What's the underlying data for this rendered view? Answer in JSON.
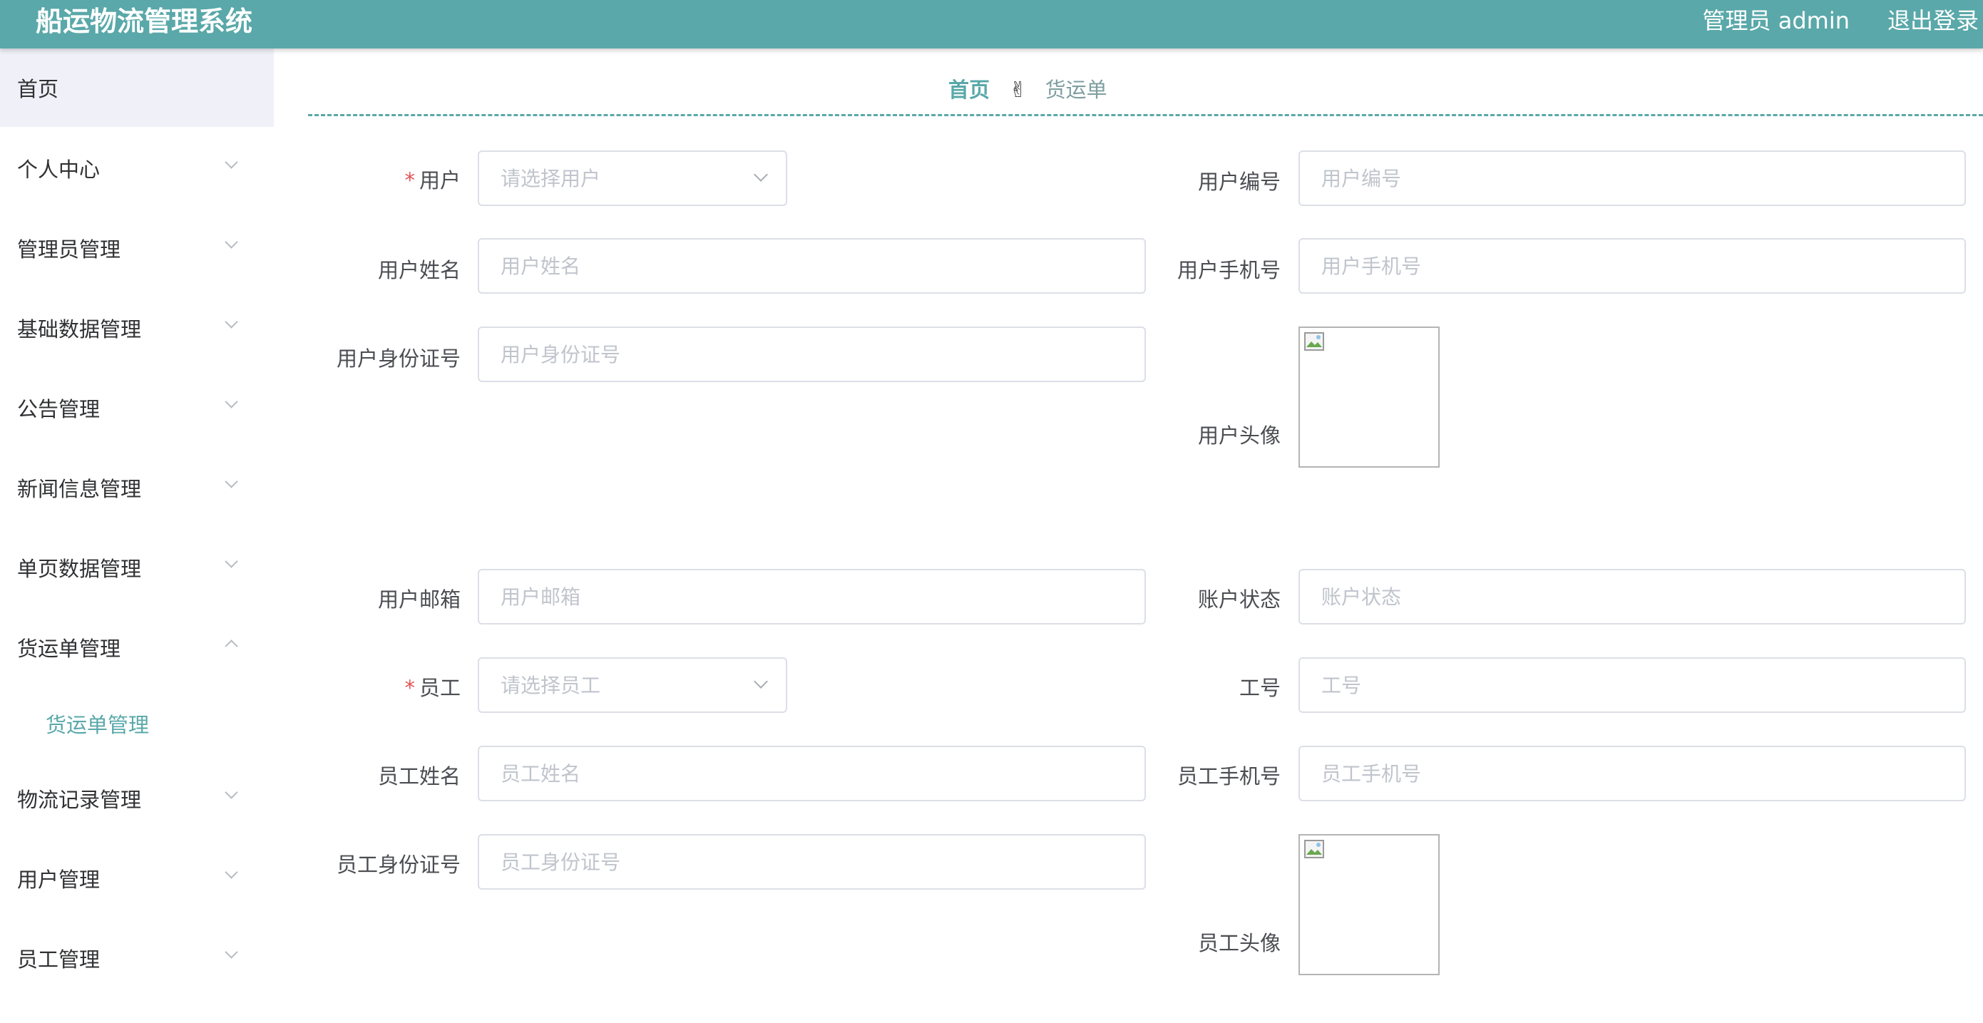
{
  "header": {
    "app_title": "船运物流管理系统",
    "user_label": "管理员 admin",
    "logout_label": "退出登录"
  },
  "sidebar": {
    "items": [
      {
        "label": "首页"
      },
      {
        "label": "个人中心"
      },
      {
        "label": "管理员管理"
      },
      {
        "label": "基础数据管理"
      },
      {
        "label": "公告管理"
      },
      {
        "label": "新闻信息管理"
      },
      {
        "label": "单页数据管理"
      },
      {
        "label": "货运单管理",
        "expanded": true
      },
      {
        "label": "物流记录管理"
      },
      {
        "label": "用户管理"
      },
      {
        "label": "员工管理"
      }
    ],
    "submenu": [
      {
        "label": "货运单管理",
        "active": true
      }
    ]
  },
  "breadcrumb": {
    "home": "首页",
    "separator_icon": "hand-icon",
    "current": "货运单"
  },
  "form": {
    "user": {
      "label": "用户",
      "required": true,
      "placeholder": "请选择用户"
    },
    "user_no": {
      "label": "用户编号",
      "placeholder": "用户编号"
    },
    "user_name": {
      "label": "用户姓名",
      "placeholder": "用户姓名"
    },
    "user_phone": {
      "label": "用户手机号",
      "placeholder": "用户手机号"
    },
    "user_id_card": {
      "label": "用户身份证号",
      "placeholder": "用户身份证号"
    },
    "user_avatar": {
      "label": "用户头像"
    },
    "user_email": {
      "label": "用户邮箱",
      "placeholder": "用户邮箱"
    },
    "account_status": {
      "label": "账户状态",
      "placeholder": "账户状态"
    },
    "staff": {
      "label": "员工",
      "required": true,
      "placeholder": "请选择员工"
    },
    "staff_no": {
      "label": "工号",
      "placeholder": "工号"
    },
    "staff_name": {
      "label": "员工姓名",
      "placeholder": "员工姓名"
    },
    "staff_phone": {
      "label": "员工手机号",
      "placeholder": "员工手机号"
    },
    "staff_id_card": {
      "label": "员工身份证号",
      "placeholder": "员工身份证号"
    },
    "staff_avatar": {
      "label": "员工头像"
    }
  },
  "colors": {
    "brand": "#5aa8a9",
    "required": "#e05555",
    "menu_active_bg": "#f0f0f8"
  }
}
